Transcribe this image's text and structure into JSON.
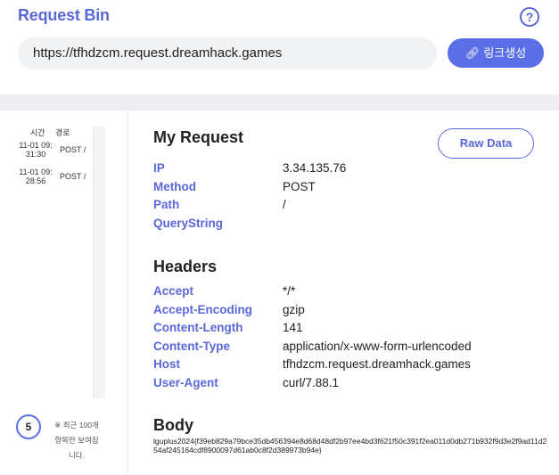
{
  "header": {
    "title": "Request Bin",
    "help_icon": "question-circle-icon",
    "url": "https://tfhdzcm.request.dreamhack.games",
    "generate_button": "링크생성",
    "generate_icon": "link-icon",
    "accent_color": "#5a6ee8"
  },
  "sidebar": {
    "col_time": "시간",
    "col_path": "경로",
    "requests": [
      {
        "time": "11-01 09:31:30",
        "time_line1": "11-01 09:",
        "time_line2": "31:30",
        "method_path": "POST /"
      },
      {
        "time": "11-01 09:28:56",
        "time_line1": "11-01 09:",
        "time_line2": "28:56",
        "method_path": "POST /"
      }
    ],
    "count": "5",
    "note_line1": "※ 최근 100개",
    "note_line2": "항목만 보여집",
    "note_line3": "니다."
  },
  "request": {
    "title": "My Request",
    "raw_button": "Raw Data",
    "fields": {
      "ip_label": "IP",
      "ip_value": "3.34.135.76",
      "method_label": "Method",
      "method_value": "POST",
      "path_label": "Path",
      "path_value": "/",
      "query_label": "QueryString",
      "query_value": ""
    }
  },
  "headers": {
    "title": "Headers",
    "accept_label": "Accept",
    "accept_value": "*/*",
    "encoding_label": "Accept-Encoding",
    "encoding_value": "gzip",
    "length_label": "Content-Length",
    "length_value": "141",
    "type_label": "Content-Type",
    "type_value": "application/x-www-form-urlencoded",
    "host_label": "Host",
    "host_value": "tfhdzcm.request.dreamhack.games",
    "agent_label": "User-Agent",
    "agent_value": "curl/7.88.1"
  },
  "body": {
    "title": "Body",
    "content": "lguplus2024{f39eb829a79bce35db456394e8d68d48df2b97ee4bd3f621f50c391f2ea011d0db271b932f9d3e2f9ad11d254af245164cdf8900097d61ab0c8f2d389973b94e}"
  }
}
